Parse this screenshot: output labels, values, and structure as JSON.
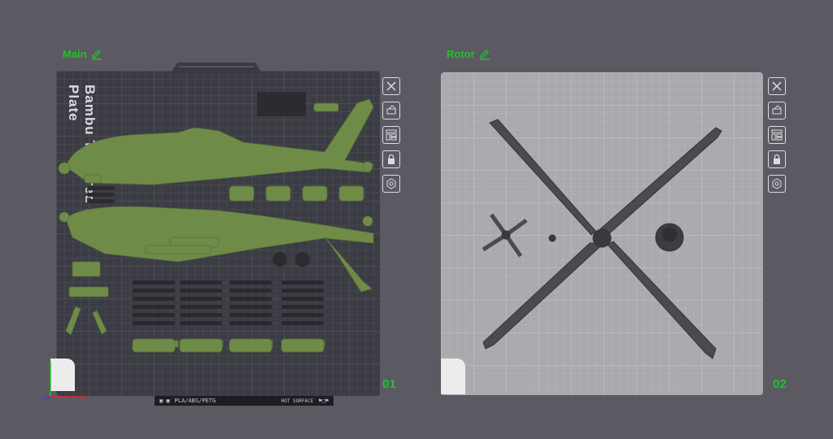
{
  "plates": [
    {
      "title": "Main",
      "number": "01",
      "type": "dark",
      "brand_text": "Bambu Textured PEI Plate",
      "label": {
        "filament": "PLA/ABS/PETG",
        "warning": "HOT SURFACE"
      }
    },
    {
      "title": "Rotor",
      "number": "02",
      "type": "light"
    }
  ],
  "toolbar_icons": [
    "close-icon",
    "auto-orient-icon",
    "arrange-icon",
    "lock-icon",
    "settings-icon"
  ],
  "colors": {
    "accent": "#22c02a",
    "model_green": "#6f8b48",
    "model_gray": "#4a4a4f"
  }
}
